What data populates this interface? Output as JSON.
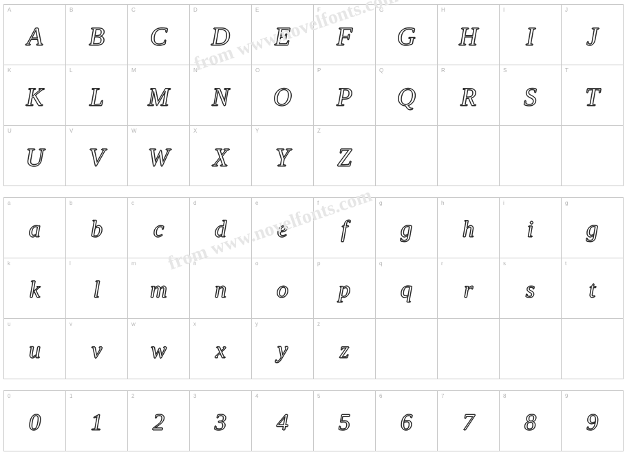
{
  "page": {
    "background_color": "#ffffff",
    "grid_line_color": "#c9c9c9",
    "label_color": "#b4b4b4",
    "glyph_stroke_color": "#2a2a2a",
    "glyph_fill_color": "#ffffff",
    "watermark_color": "#e6e6e6"
  },
  "watermarks": [
    {
      "text": "from www.novelfonts.com"
    },
    {
      "text": "from www.novelfonts.com"
    }
  ],
  "blocks": [
    {
      "name": "uppercase",
      "rows": [
        [
          {
            "label": "A",
            "glyph": "A"
          },
          {
            "label": "B",
            "glyph": "B"
          },
          {
            "label": "C",
            "glyph": "C"
          },
          {
            "label": "D",
            "glyph": "D"
          },
          {
            "label": "E",
            "glyph": "E"
          },
          {
            "label": "F",
            "glyph": "F"
          },
          {
            "label": "G",
            "glyph": "G"
          },
          {
            "label": "H",
            "glyph": "H"
          },
          {
            "label": "I",
            "glyph": "I"
          },
          {
            "label": "J",
            "glyph": "J"
          }
        ],
        [
          {
            "label": "K",
            "glyph": "K"
          },
          {
            "label": "L",
            "glyph": "L"
          },
          {
            "label": "M",
            "glyph": "M"
          },
          {
            "label": "N",
            "glyph": "N"
          },
          {
            "label": "O",
            "glyph": "O"
          },
          {
            "label": "P",
            "glyph": "P"
          },
          {
            "label": "Q",
            "glyph": "Q"
          },
          {
            "label": "R",
            "glyph": "R"
          },
          {
            "label": "S",
            "glyph": "S"
          },
          {
            "label": "T",
            "glyph": "T"
          }
        ],
        [
          {
            "label": "U",
            "glyph": "U"
          },
          {
            "label": "V",
            "glyph": "V"
          },
          {
            "label": "W",
            "glyph": "W"
          },
          {
            "label": "X",
            "glyph": "X"
          },
          {
            "label": "Y",
            "glyph": "Y"
          },
          {
            "label": "Z",
            "glyph": "Z"
          },
          {
            "label": "",
            "glyph": ""
          },
          {
            "label": "",
            "glyph": ""
          },
          {
            "label": "",
            "glyph": ""
          },
          {
            "label": "",
            "glyph": ""
          }
        ]
      ]
    },
    {
      "name": "lowercase",
      "rows": [
        [
          {
            "label": "a",
            "glyph": "a"
          },
          {
            "label": "b",
            "glyph": "b"
          },
          {
            "label": "c",
            "glyph": "c"
          },
          {
            "label": "d",
            "glyph": "d"
          },
          {
            "label": "e",
            "glyph": "e"
          },
          {
            "label": "f",
            "glyph": "f"
          },
          {
            "label": "g",
            "glyph": "g"
          },
          {
            "label": "h",
            "glyph": "h"
          },
          {
            "label": "i",
            "glyph": "i"
          },
          {
            "label": "g",
            "glyph": "g"
          }
        ],
        [
          {
            "label": "k",
            "glyph": "k"
          },
          {
            "label": "l",
            "glyph": "l"
          },
          {
            "label": "m",
            "glyph": "m"
          },
          {
            "label": "n",
            "glyph": "n"
          },
          {
            "label": "o",
            "glyph": "o"
          },
          {
            "label": "p",
            "glyph": "p"
          },
          {
            "label": "q",
            "glyph": "q"
          },
          {
            "label": "r",
            "glyph": "r"
          },
          {
            "label": "s",
            "glyph": "s"
          },
          {
            "label": "t",
            "glyph": "t"
          }
        ],
        [
          {
            "label": "u",
            "glyph": "u"
          },
          {
            "label": "v",
            "glyph": "v"
          },
          {
            "label": "w",
            "glyph": "w"
          },
          {
            "label": "x",
            "glyph": "x"
          },
          {
            "label": "y",
            "glyph": "y"
          },
          {
            "label": "z",
            "glyph": "z"
          },
          {
            "label": "",
            "glyph": ""
          },
          {
            "label": "",
            "glyph": ""
          },
          {
            "label": "",
            "glyph": ""
          },
          {
            "label": "",
            "glyph": ""
          }
        ]
      ]
    },
    {
      "name": "digits",
      "rows": [
        [
          {
            "label": "0",
            "glyph": "0"
          },
          {
            "label": "1",
            "glyph": "1"
          },
          {
            "label": "2",
            "glyph": "2"
          },
          {
            "label": "3",
            "glyph": "3"
          },
          {
            "label": "4",
            "glyph": "4"
          },
          {
            "label": "5",
            "glyph": "5"
          },
          {
            "label": "6",
            "glyph": "6"
          },
          {
            "label": "7",
            "glyph": "7"
          },
          {
            "label": "8",
            "glyph": "8"
          },
          {
            "label": "9",
            "glyph": "9"
          }
        ]
      ]
    }
  ]
}
